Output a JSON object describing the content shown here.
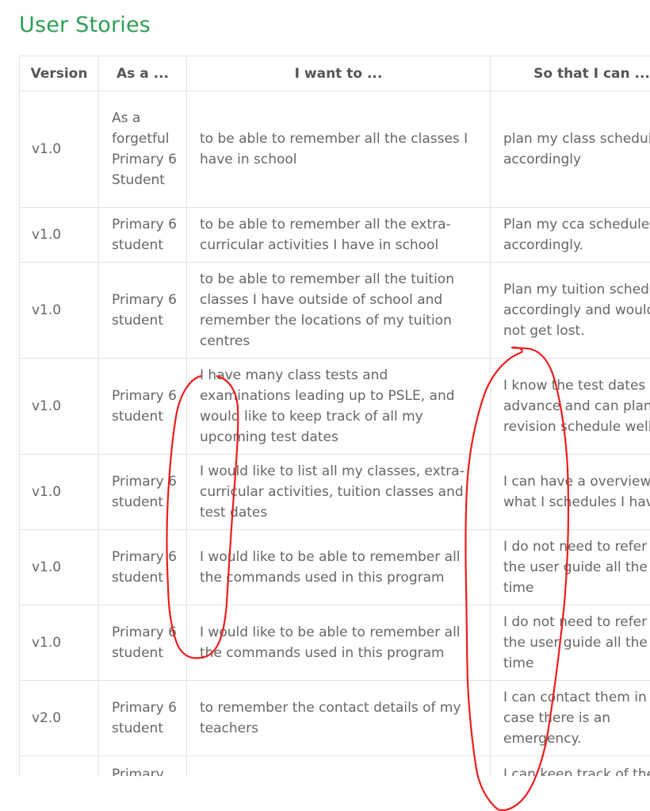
{
  "title": "User Stories",
  "table": {
    "headers": [
      "Version",
      "As a ...",
      "I want to ...",
      "So that I can ..."
    ],
    "rows": [
      {
        "version": "v1.0",
        "as_a": "As a forgetful Primary 6 Student",
        "want": "to be able to remember all the classes I have in school",
        "so_that": "plan my class schedule accordingly"
      },
      {
        "version": "v1.0",
        "as_a": "Primary 6 student",
        "want": "to be able to remember all the extra-curricular activities I have in school",
        "so_that": "Plan my cca schedule accordingly."
      },
      {
        "version": "v1.0",
        "as_a": "Primary 6 student",
        "want": "to be able to remember all the tuition classes I have outside of school and remember the locations of my tuition centres",
        "so_that": "Plan my tuition schedule accordingly and would not get lost."
      },
      {
        "version": "v1.0",
        "as_a": "Primary 6 student",
        "want": "I have many class tests and examinations leading up to PSLE, and would like to keep track of all my upcoming test dates",
        "so_that": "I know the test dates in advance and can plan my revision schedule well."
      },
      {
        "version": "v1.0",
        "as_a": "Primary 6 student",
        "want": "I would like to list all my classes, extra-curricular activities, tuition classes and test dates",
        "so_that": "I can have a overview of what I schedules I have"
      },
      {
        "version": "v1.0",
        "as_a": "Primary 6 student",
        "want": "I would like to be able to remember all the commands used in this program",
        "so_that": "I do not need to refer to the user guide all the time"
      },
      {
        "version": "v1.0",
        "as_a": "Primary 6 student",
        "want": "I would like to be able to remember all the commands used in this program",
        "so_that": "I do not need to refer to the user guide all the time"
      },
      {
        "version": "v2.0",
        "as_a": "Primary 6 student",
        "want": "to remember the contact details of my teachers",
        "so_that": "I can contact them in case there is an emergency."
      },
      {
        "version": "",
        "as_a": "Primary",
        "want": "",
        "so_that": "I can keep track of the"
      }
    ]
  },
  "annotations": {
    "stroke_color": "#ee1c1c"
  }
}
